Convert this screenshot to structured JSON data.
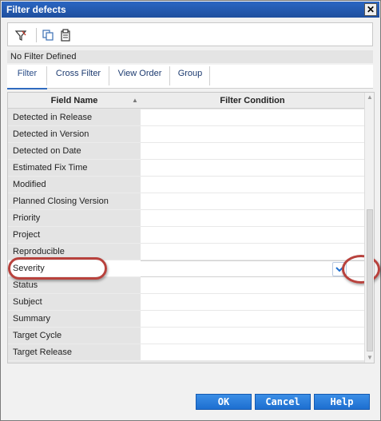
{
  "window": {
    "title": "Filter defects",
    "close_glyph": "✕"
  },
  "toolbar": {
    "icons": [
      "filter-icon",
      "copy-icon",
      "paste-icon"
    ]
  },
  "status_text": "No Filter Defined",
  "tabs": [
    {
      "label": "Filter",
      "active": true
    },
    {
      "label": "Cross Filter",
      "active": false
    },
    {
      "label": "View Order",
      "active": false
    },
    {
      "label": "Group",
      "active": false
    }
  ],
  "grid": {
    "col_field": "Field Name",
    "col_condition": "Filter Condition",
    "rows": [
      {
        "field": "Detected in Release",
        "condition": ""
      },
      {
        "field": "Detected in Version",
        "condition": ""
      },
      {
        "field": "Detected on Date",
        "condition": ""
      },
      {
        "field": "Estimated Fix Time",
        "condition": ""
      },
      {
        "field": "Modified",
        "condition": ""
      },
      {
        "field": "Planned Closing Version",
        "condition": ""
      },
      {
        "field": "Priority",
        "condition": ""
      },
      {
        "field": "Project",
        "condition": ""
      },
      {
        "field": "Reproducible",
        "condition": ""
      },
      {
        "field": "Severity",
        "condition": "",
        "selected": true
      },
      {
        "field": "Status",
        "condition": ""
      },
      {
        "field": "Subject",
        "condition": ""
      },
      {
        "field": "Summary",
        "condition": ""
      },
      {
        "field": "Target Cycle",
        "condition": ""
      },
      {
        "field": "Target Release",
        "condition": ""
      }
    ]
  },
  "buttons": {
    "ok": "OK",
    "cancel": "Cancel",
    "help": "Help"
  },
  "colors": {
    "title_bar": "#1e4f9e",
    "accent_button": "#1d6fd0",
    "highlight_ring": "#b8423d"
  }
}
